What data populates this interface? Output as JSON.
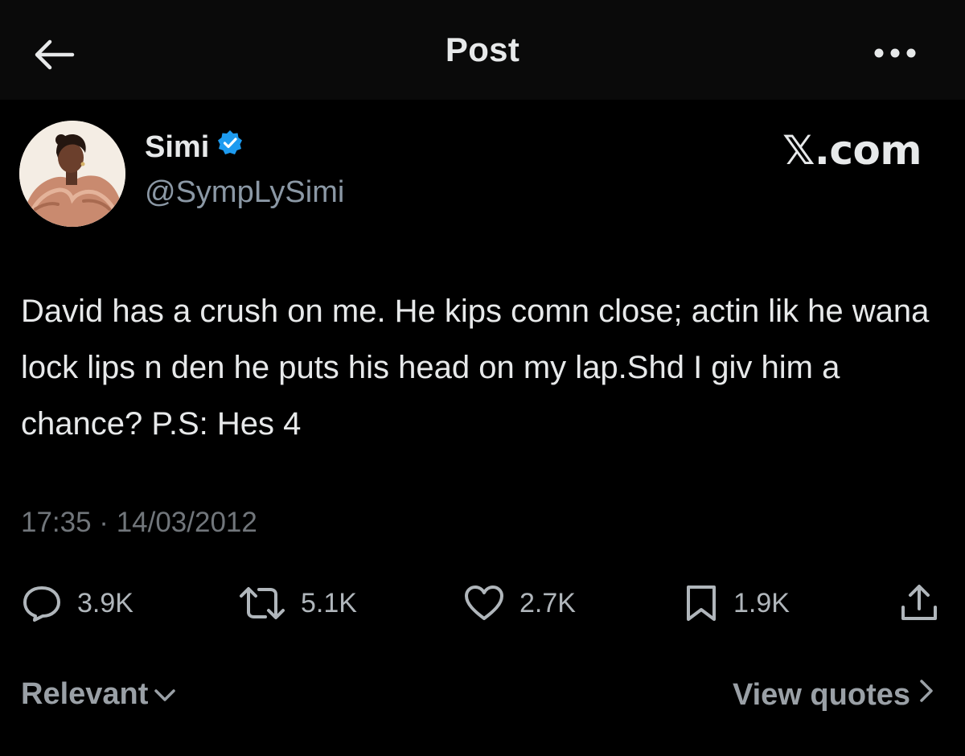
{
  "header": {
    "title": "Post",
    "back_icon": "back-arrow-icon",
    "more_icon": "more-options-icon"
  },
  "author": {
    "display_name": "Simi",
    "handle": "@SympLySimi",
    "verified": true,
    "verified_color": "#1d9bf0",
    "avatar_icon": "avatar-portrait"
  },
  "watermark": "𝕏.com",
  "tweet": {
    "text": "David has a crush on me. He kips comn close; actin lik he wana lock lips n den he puts his head on my lap.Shd I giv him a chance? P.S: Hes 4",
    "timestamp": "17:35 · 14/03/2012"
  },
  "actions": {
    "replies": "3.9K",
    "retweets": "5.1K",
    "likes": "2.7K",
    "bookmarks": "1.9K"
  },
  "footer": {
    "sort_label": "Relevant",
    "view_quotes_label": "View quotes"
  },
  "colors": {
    "background": "#000000",
    "text": "#e7e9ea",
    "muted": "#71767b",
    "accent": "#1d9bf0"
  }
}
